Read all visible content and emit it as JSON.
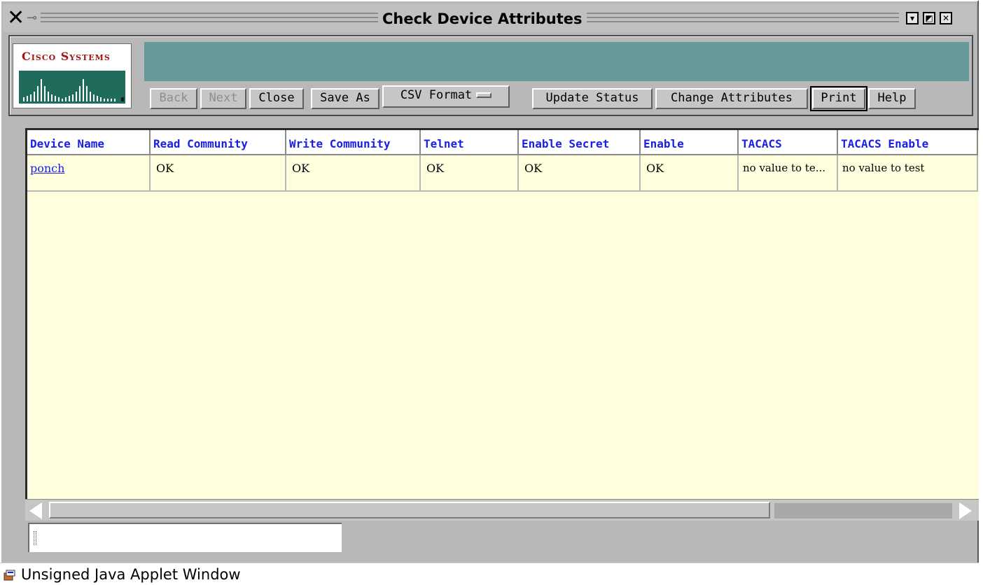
{
  "window": {
    "title": "Check Device Attributes"
  },
  "logo": {
    "text": "Cisco Systems"
  },
  "toolbar": {
    "buttons": [
      {
        "label": "Back",
        "enabled": false
      },
      {
        "label": "Next",
        "enabled": false
      },
      {
        "label": "Close",
        "enabled": true
      },
      {
        "label": "Save As",
        "enabled": true
      },
      {
        "label": "CSV Format",
        "enabled": true
      },
      {
        "label": "Update Status",
        "enabled": true
      },
      {
        "label": "Change Attributes",
        "enabled": true
      },
      {
        "label": "Print",
        "enabled": true
      },
      {
        "label": "Help",
        "enabled": true
      }
    ]
  },
  "table": {
    "columns": [
      "Device Name",
      "Read Community",
      "Write Community",
      "Telnet",
      "Enable Secret",
      "Enable",
      "TACACS",
      "TACACS Enable"
    ],
    "rows": [
      [
        "ponch",
        "OK",
        "OK",
        "OK",
        "OK",
        "OK",
        "no value to te...",
        "no value to test"
      ]
    ]
  },
  "status_field": {
    "value": ""
  },
  "applet_warning": {
    "text": "Unsigned Java Applet Window"
  },
  "colors": {
    "banner": "#66999a",
    "table_background": "#ffffdd",
    "header_text": "#1a20e6",
    "logo_red": "#a01414"
  }
}
